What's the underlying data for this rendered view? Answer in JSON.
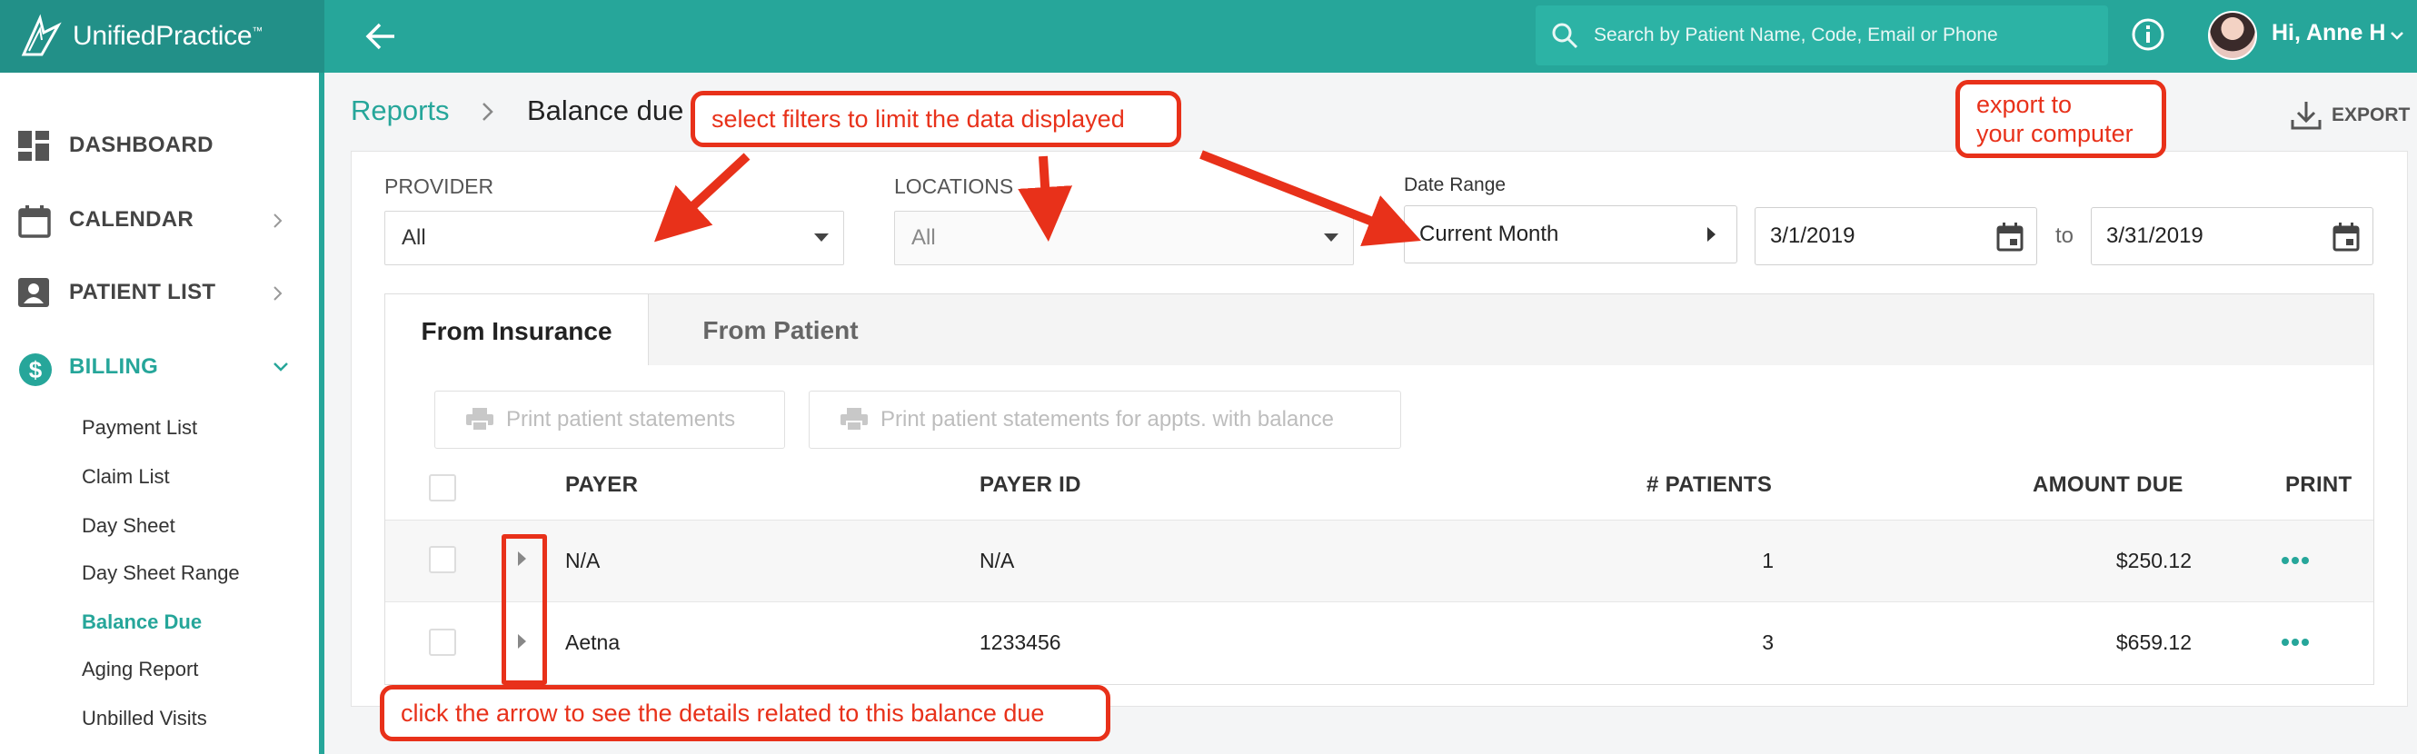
{
  "app": {
    "logo_name": "UnifiedPractice",
    "logo_tm": "™"
  },
  "header": {
    "search_placeholder": "Search by Patient Name, Code, Email or Phone",
    "user_greeting": "Hi, Anne H"
  },
  "sidebar": {
    "items": [
      {
        "label": "DASHBOARD",
        "icon": "dashboard-icon"
      },
      {
        "label": "CALENDAR",
        "icon": "calendar-icon"
      },
      {
        "label": "PATIENT LIST",
        "icon": "patient-list-icon"
      },
      {
        "label": "BILLING",
        "icon": "billing-dollar-icon"
      }
    ],
    "billing_sub": [
      "Payment List",
      "Claim List",
      "Day Sheet",
      "Day Sheet Range",
      "Balance Due",
      "Aging Report",
      "Unbilled Visits"
    ]
  },
  "breadcrumb": {
    "parent": "Reports",
    "current": "Balance due"
  },
  "export_label": "EXPORT",
  "filters": {
    "provider_label": "PROVIDER",
    "provider_value": "All",
    "locations_label": "LOCATIONS",
    "locations_value": "All",
    "date_range_label": "Date Range",
    "date_range_value": "Current Month",
    "start_date": "3/1/2019",
    "to_label": "to",
    "end_date": "3/31/2019"
  },
  "tabs": [
    {
      "label": "From Insurance",
      "active": true
    },
    {
      "label": "From Patient",
      "active": false
    }
  ],
  "actions": {
    "print_statements": "Print patient statements",
    "print_statements_balance": "Print patient statements for appts. with balance"
  },
  "table": {
    "columns": {
      "payer": "PAYER",
      "payer_id": "PAYER ID",
      "patients": "# PATIENTS",
      "amount_due": "AMOUNT DUE",
      "print": "PRINT"
    },
    "rows": [
      {
        "payer": "N/A",
        "payer_id": "N/A",
        "patients": "1",
        "amount_due": "$250.12"
      },
      {
        "payer": "Aetna",
        "payer_id": "1233456",
        "patients": "3",
        "amount_due": "$659.12"
      }
    ]
  },
  "annotations": {
    "filters": "select filters to limit the data displayed",
    "export": "export to your computer",
    "export_line1": "export to",
    "export_line2": "your computer",
    "arrow": "click the arrow to see the details related to this balance due"
  },
  "colors": {
    "brand": "#26a69a",
    "annotation": "#e8311a"
  }
}
